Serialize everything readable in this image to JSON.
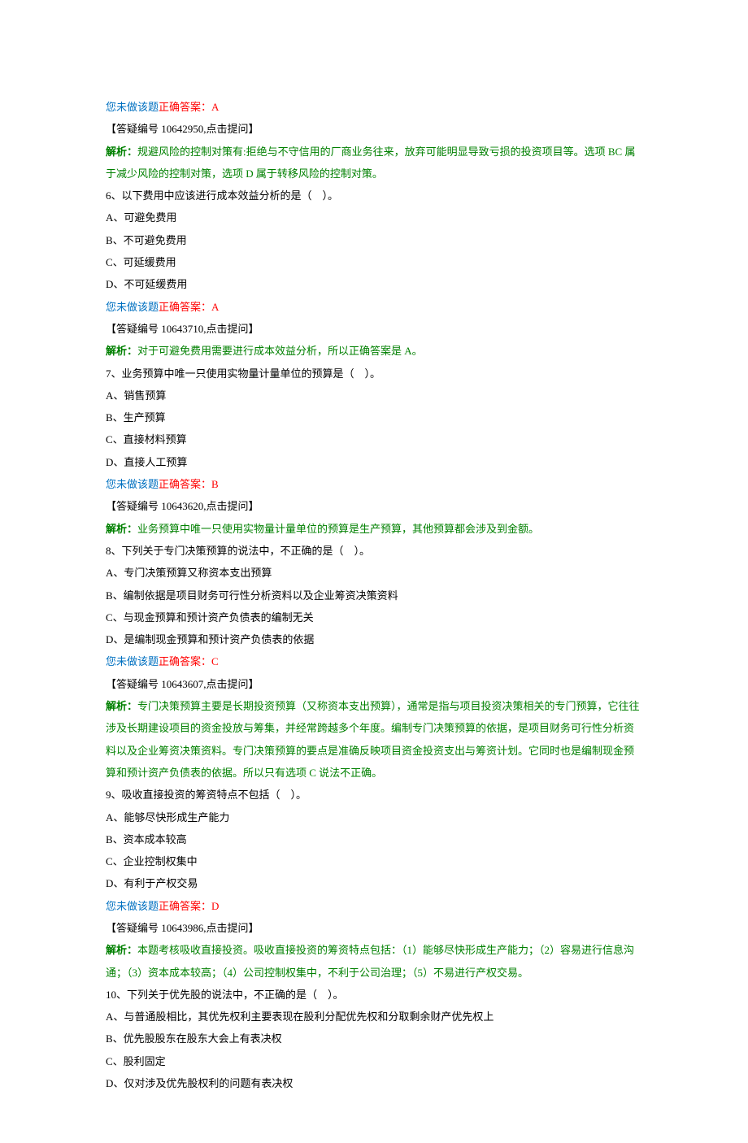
{
  "labels": {
    "not_done": "您未做该题",
    "correct_prefix": "正确答案：",
    "jiexi_prefix": "解析："
  },
  "items": [
    {
      "correct": "A",
      "ref": "【答疑编号 10642950,点击提问】",
      "jiexi": "规避风险的控制对策有:拒绝与不守信用的厂商业务往来，放弃可能明显导致亏损的投资项目等。选项 BC 属于减少风险的控制对策，选项 D 属于转移风险的控制对策。"
    },
    {
      "question": "6、以下费用中应该进行成本效益分析的是（　）。",
      "options": [
        "A、可避免费用",
        "B、不可避免费用",
        "C、可延缓费用",
        "D、不可延缓费用"
      ],
      "correct": "A",
      "ref": "【答疑编号 10643710,点击提问】",
      "jiexi": "对于可避免费用需要进行成本效益分析，所以正确答案是 A。"
    },
    {
      "question": "7、业务预算中唯一只使用实物量计量单位的预算是（　）。",
      "options": [
        "A、销售预算",
        "B、生产预算",
        "C、直接材料预算",
        "D、直接人工预算"
      ],
      "correct": "B",
      "ref": "【答疑编号 10643620,点击提问】",
      "jiexi": "业务预算中唯一只使用实物量计量单位的预算是生产预算，其他预算都会涉及到金额。"
    },
    {
      "question": "8、下列关于专门决策预算的说法中，不正确的是（　）。",
      "options": [
        "A、专门决策预算又称资本支出预算",
        "B、编制依据是项目财务可行性分析资料以及企业筹资决策资料",
        "C、与现金预算和预计资产负债表的编制无关",
        "D、是编制现金预算和预计资产负债表的依据"
      ],
      "correct": "C",
      "ref": "【答疑编号 10643607,点击提问】",
      "jiexi": "专门决策预算主要是长期投资预算（又称资本支出预算），通常是指与项目投资决策相关的专门预算，它往往涉及长期建设项目的资金投放与筹集，并经常跨越多个年度。编制专门决策预算的依据，是项目财务可行性分析资料以及企业筹资决策资料。专门决策预算的要点是准确反映项目资金投资支出与筹资计划。它同时也是编制现金预算和预计资产负债表的依据。所以只有选项 C 说法不正确。"
    },
    {
      "question": "9、吸收直接投资的筹资特点不包括（　）。",
      "options": [
        "A、能够尽快形成生产能力",
        "B、资本成本较高",
        "C、企业控制权集中",
        "D、有利于产权交易"
      ],
      "correct": "D",
      "ref": "【答疑编号 10643986,点击提问】",
      "jiexi": "本题考核吸收直接投资。吸收直接投资的筹资特点包括：（1）能够尽快形成生产能力；（2）容易进行信息沟通；（3）资本成本较高；（4）公司控制权集中，不利于公司治理；（5）不易进行产权交易。"
    },
    {
      "question": "10、下列关于优先股的说法中，不正确的是（　）。",
      "options": [
        "A、与普通股相比，其优先权利主要表现在股利分配优先权和分取剩余财产优先权上",
        "B、优先股股东在股东大会上有表决权",
        "C、股利固定",
        "D、仅对涉及优先股权利的问题有表决权"
      ]
    }
  ]
}
